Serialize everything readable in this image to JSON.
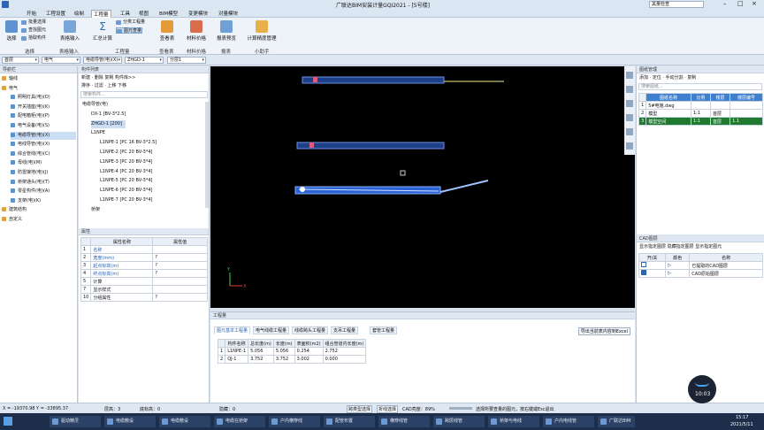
{
  "app": {
    "title": "广联达BIM安装计量GQI2021 - [5号楼]",
    "search_value": "黑量检查"
  },
  "menu": [
    "开始",
    "工程设置",
    "绘制",
    "工程量",
    "工具",
    "视图",
    "BIM模型",
    "变更模块",
    "对量模块"
  ],
  "ribbon": {
    "btn_select": "选择",
    "btn_batch_select": "批量选择",
    "btn_find_element": "查找图元",
    "btn_pick_component": "拾取构件",
    "btn_table_input": "表格输入",
    "btn_summary": "汇总计算",
    "btn_separate_qty": "分类工程量",
    "btn_view_qty": "图元查量",
    "btn_check_table": "查看表",
    "btn_material_price": "材料价格",
    "btn_report_preview": "报表预览",
    "btn_accuracy_mgmt": "计算精度管理",
    "grp_select": "选择",
    "grp_input": "表格输入",
    "grp_qty": "工程量",
    "grp_checktable": "查看表",
    "grp_price": "材料价格",
    "grp_report": "报表",
    "grp_assistant": "小助手"
  },
  "combos": [
    "首层",
    "电气",
    "电缆导管(电)(X)",
    "ZHGD-1",
    "分层1"
  ],
  "nav": {
    "header": "导航栏",
    "items": [
      {
        "label": "轴线",
        "level": 0
      },
      {
        "label": "电气",
        "level": 0
      },
      {
        "label": "照明灯具(电)(D)",
        "level": 1
      },
      {
        "label": "开关插座(电)(K)",
        "level": 1
      },
      {
        "label": "配电箱柜(电)(P)",
        "level": 1
      },
      {
        "label": "电气设备(电)(S)",
        "level": 1
      },
      {
        "label": "电缆导管(电)(X)",
        "level": 1,
        "selected": true
      },
      {
        "label": "电线导管(电)(X)",
        "level": 1
      },
      {
        "label": "综合管线(电)(C)",
        "level": 1
      },
      {
        "label": "母线(电)(M)",
        "level": 1
      },
      {
        "label": "防雷接地(电)(J)",
        "level": 1
      },
      {
        "label": "桥架通头(电)(T)",
        "level": 1
      },
      {
        "label": "零星构件(电)(A)",
        "level": 1
      },
      {
        "label": "支架(电)(K)",
        "level": 1
      },
      {
        "label": "建筑结构",
        "level": 0
      },
      {
        "label": "自定义",
        "level": 0
      }
    ]
  },
  "complist": {
    "header": "构件列表",
    "toolbar1": "新建 · 删除 复制 构件库>>",
    "toolbar2": "排序 · 过滤 · 上移 下移",
    "search_placeholder": "搜索构件...",
    "tree": [
      {
        "label": "电缆导管(电)",
        "indent": 0
      },
      {
        "label": "DX-1 [BV-3*2.5]",
        "indent": 1
      },
      {
        "label": "ZHGD-1 [200]",
        "indent": 1,
        "selected": true
      },
      {
        "label": "L1NPE",
        "indent": 1
      },
      {
        "label": "L1NPE-1 [PC 16 BV-3*2.5]",
        "indent": 2
      },
      {
        "label": "L1NPE-2 [PC 20 BV-3*4]",
        "indent": 2
      },
      {
        "label": "L1NPE-3 [PC 20 BV-3*4]",
        "indent": 2
      },
      {
        "label": "L1NPE-4 [PC 20 BV-3*4]",
        "indent": 2
      },
      {
        "label": "L1NPE-5 [PC 20 BV-3*4]",
        "indent": 2
      },
      {
        "label": "L1NPE-6 [PC 20 BV-3*4]",
        "indent": 2
      },
      {
        "label": "L1NPE-7 [PC 20 BV-3*4]",
        "indent": 2
      },
      {
        "label": "桥架",
        "indent": 1
      }
    ]
  },
  "props": {
    "header": "属性",
    "col_name": "属性名称",
    "col_value": "属性值",
    "rows": [
      {
        "no": "1",
        "name": "名称",
        "value": ""
      },
      {
        "no": "2",
        "name": "宽度(mm)",
        "value": "?"
      },
      {
        "no": "3",
        "name": "起点标高(m)",
        "value": "?"
      },
      {
        "no": "4",
        "name": "终点标高(m)",
        "value": "?"
      },
      {
        "no": "5",
        "name": "计算",
        "value": ""
      },
      {
        "no": "7",
        "name": "显示样式",
        "value": ""
      },
      {
        "no": "10",
        "name": "分组属性",
        "value": "?"
      }
    ]
  },
  "qty": {
    "header": "工程量",
    "tabs": [
      "图元基本工程量",
      "电气线缆工程量",
      "线缆跨头工程量",
      "支吊工程量",
      "套管工程量"
    ],
    "export_label": "导出当前表内容到Excel",
    "columns": [
      "构件名称",
      "总长度(m)",
      "长度(m)",
      "表面积(m2)",
      "组合管道内长度(m)"
    ],
    "rows": [
      {
        "no": "1",
        "cells": [
          "L1NPE-1",
          "5.056",
          "5.056",
          "0.254",
          "2.752"
        ]
      },
      {
        "no": "2",
        "cells": [
          "QJ-1",
          "3.752",
          "3.752",
          "3.002",
          "0.000"
        ]
      }
    ]
  },
  "drawing": {
    "header": "图纸管理",
    "toolbar": "添加 · 定位 · 手动分割 · 复制",
    "search_placeholder": "搜索图纸...",
    "columns": [
      "图纸名称",
      "比例",
      "楼层",
      "楼层编号"
    ],
    "rows": [
      {
        "no": "1",
        "name": "5#电施.dwg",
        "scale": "",
        "floor": "",
        "code": ""
      },
      {
        "no": "2",
        "name": "模型",
        "scale": "1:1",
        "floor": "首层",
        "code": ""
      },
      {
        "no": "3",
        "name": "模型空间",
        "scale": "1:1",
        "floor": "首层",
        "code": "1.1"
      }
    ]
  },
  "cad": {
    "header": "CAD图层",
    "toolbar": "显示指定图层  隐藏指定图层  显示指定图元",
    "columns": [
      "开/关",
      "颜色",
      "名称"
    ],
    "rows": [
      {
        "name": "已提取的CAD图层"
      },
      {
        "name": "CAD原始图层"
      }
    ]
  },
  "status": {
    "coords": "X = -19370.98 Y = -33895.37",
    "floor_height": "层高：3",
    "base_height": "底标高：0",
    "hidden": "隐藏：0",
    "cad_brightness": "CAD亮度：89%",
    "cross_select": "跨类型选择",
    "polyline_select": "折线选择",
    "hint": "选择所要查量的图元，按右键或Esc退出"
  },
  "taskbar": {
    "items": [
      "驱动精灵",
      "电缆敷设",
      "电缆敷设",
      "电缆在桥架",
      "户内横穿线",
      "配管布置",
      "横穿线管",
      "跨层线管",
      "桥架与电线",
      "户内电线管",
      "广联达BIM"
    ],
    "time": "15:17",
    "date": "2021/5/11",
    "bubble": "10:03"
  },
  "colors": {
    "accent": "#2a66b5",
    "canvas_bg": "#000000",
    "pipe": "#3a6fd8",
    "highlight": "#ffff66"
  }
}
